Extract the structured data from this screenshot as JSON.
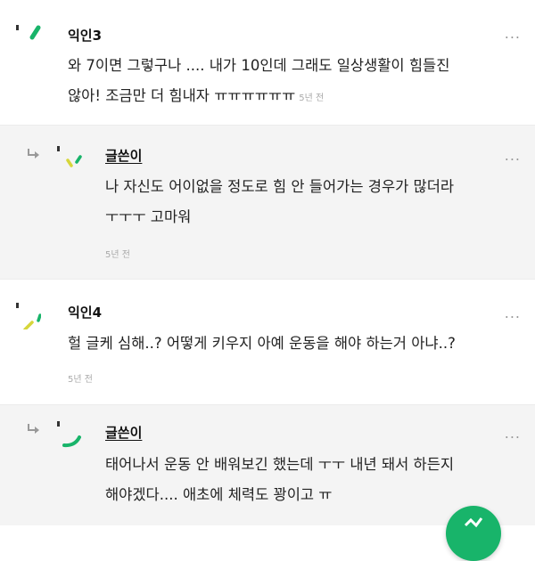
{
  "comments": [
    {
      "author": "익인3",
      "lines": [
        "와 7이면 그렇구나 .... 내가 10인데 그래도 일상생활이 힘들진",
        "않아! 조금만 더 힘내자 ㅠㅠㅠㅠㅠㅠ"
      ],
      "time": "5년 전",
      "more": "...",
      "avatar_icon": "green-dash-icon"
    },
    {
      "author": "글쓴이",
      "lines": [
        "나 자신도 어이없을 정도로 힘 안 들어가는 경우가 많더라",
        "ㅜㅜㅜ 고마워"
      ],
      "time": "5년 전",
      "more": "...",
      "avatar_icon": "green-yellow-dash-icon",
      "is_reply": true
    },
    {
      "author": "익인4",
      "lines": [
        "헐 글케 심해..? 어떻게 키우지 아예 운동을 해야 하는거 아냐..?"
      ],
      "time": "5년 전",
      "more": "...",
      "avatar_icon": "yellow-green-dash-icon"
    },
    {
      "author": "글쓴이",
      "lines": [
        "태어나서 운동 안 배워보긴 했는데 ㅜㅜ 내년 돼서 하든지",
        "해야겠다.... 애초에 체력도 꽝이고 ㅠ"
      ],
      "more": "...",
      "avatar_icon": "green-curve-icon",
      "is_reply": true
    }
  ],
  "colors": {
    "accent": "#18b46a",
    "yellow": "#d6d63a",
    "reply_bg": "#f4f4f4"
  },
  "fab_icon": "chart-icon"
}
